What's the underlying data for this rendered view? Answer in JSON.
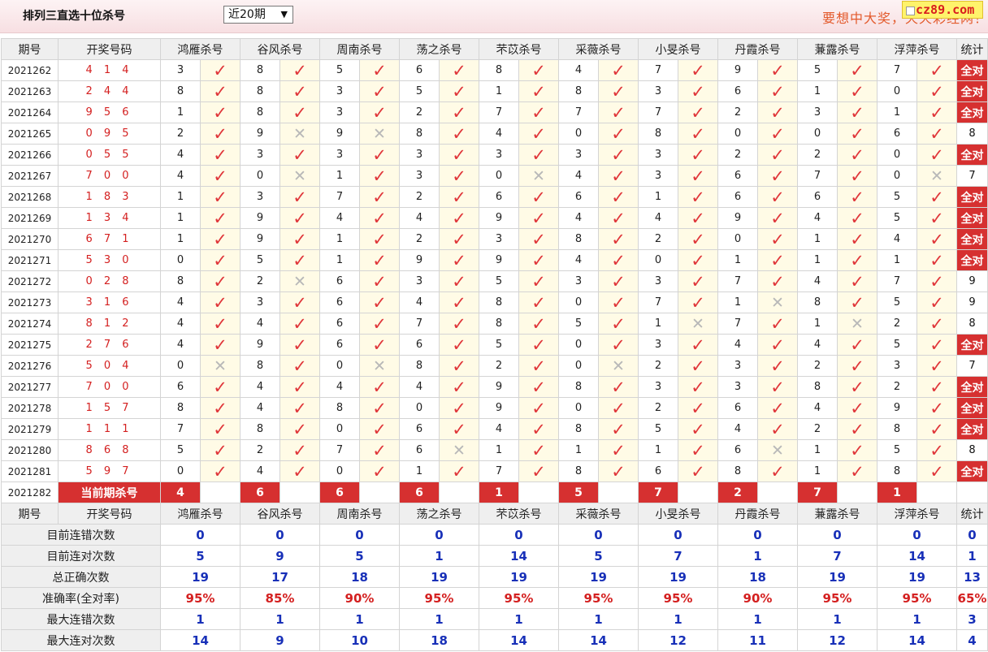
{
  "header": {
    "title": "排列三直选十位杀号",
    "select_value": "近20期",
    "slogan": "要想中大奖，天天彩经网！",
    "logo": "cz89.com"
  },
  "columns": {
    "issue": "期号",
    "draw": "开奖号码",
    "experts": [
      "鸿雁杀号",
      "谷风杀号",
      "周南杀号",
      "荡之杀号",
      "芣苡杀号",
      "采薇杀号",
      "小旻杀号",
      "丹霞杀号",
      "蒹露杀号",
      "浮萍杀号"
    ],
    "stat": "统计"
  },
  "rows": [
    {
      "issue": "2021262",
      "draw": "4 1 4",
      "kills": [
        3,
        8,
        5,
        6,
        8,
        4,
        7,
        9,
        5,
        7
      ],
      "ok": [
        1,
        1,
        1,
        1,
        1,
        1,
        1,
        1,
        1,
        1
      ],
      "stat": "全对"
    },
    {
      "issue": "2021263",
      "draw": "2 4 4",
      "kills": [
        8,
        8,
        3,
        5,
        1,
        8,
        3,
        6,
        1,
        0
      ],
      "ok": [
        1,
        1,
        1,
        1,
        1,
        1,
        1,
        1,
        1,
        1
      ],
      "stat": "全对"
    },
    {
      "issue": "2021264",
      "draw": "9 5 6",
      "kills": [
        1,
        8,
        3,
        2,
        7,
        7,
        7,
        2,
        3,
        1
      ],
      "ok": [
        1,
        1,
        1,
        1,
        1,
        1,
        1,
        1,
        1,
        1
      ],
      "stat": "全对"
    },
    {
      "issue": "2021265",
      "draw": "0 9 5",
      "kills": [
        2,
        9,
        9,
        8,
        4,
        0,
        8,
        0,
        0,
        6
      ],
      "ok": [
        1,
        0,
        0,
        1,
        1,
        1,
        1,
        1,
        1,
        1
      ],
      "stat": "8"
    },
    {
      "issue": "2021266",
      "draw": "0 5 5",
      "kills": [
        4,
        3,
        3,
        3,
        3,
        3,
        3,
        2,
        2,
        0
      ],
      "ok": [
        1,
        1,
        1,
        1,
        1,
        1,
        1,
        1,
        1,
        1
      ],
      "stat": "全对"
    },
    {
      "issue": "2021267",
      "draw": "7 0 0",
      "kills": [
        4,
        0,
        1,
        3,
        0,
        4,
        3,
        6,
        7,
        0
      ],
      "ok": [
        1,
        0,
        1,
        1,
        0,
        1,
        1,
        1,
        1,
        0
      ],
      "stat": "7"
    },
    {
      "issue": "2021268",
      "draw": "1 8 3",
      "kills": [
        1,
        3,
        7,
        2,
        6,
        6,
        1,
        6,
        6,
        5
      ],
      "ok": [
        1,
        1,
        1,
        1,
        1,
        1,
        1,
        1,
        1,
        1
      ],
      "stat": "全对"
    },
    {
      "issue": "2021269",
      "draw": "1 3 4",
      "kills": [
        1,
        9,
        4,
        4,
        9,
        4,
        4,
        9,
        4,
        5
      ],
      "ok": [
        1,
        1,
        1,
        1,
        1,
        1,
        1,
        1,
        1,
        1
      ],
      "stat": "全对"
    },
    {
      "issue": "2021270",
      "draw": "6 7 1",
      "kills": [
        1,
        9,
        1,
        2,
        3,
        8,
        2,
        0,
        1,
        4
      ],
      "ok": [
        1,
        1,
        1,
        1,
        1,
        1,
        1,
        1,
        1,
        1
      ],
      "stat": "全对"
    },
    {
      "issue": "2021271",
      "draw": "5 3 0",
      "kills": [
        0,
        5,
        1,
        9,
        9,
        4,
        0,
        1,
        1,
        1
      ],
      "ok": [
        1,
        1,
        1,
        1,
        1,
        1,
        1,
        1,
        1,
        1
      ],
      "stat": "全对"
    },
    {
      "issue": "2021272",
      "draw": "0 2 8",
      "kills": [
        8,
        2,
        6,
        3,
        5,
        3,
        3,
        7,
        4,
        7
      ],
      "ok": [
        1,
        0,
        1,
        1,
        1,
        1,
        1,
        1,
        1,
        1
      ],
      "stat": "9"
    },
    {
      "issue": "2021273",
      "draw": "3 1 6",
      "kills": [
        4,
        3,
        6,
        4,
        8,
        0,
        7,
        1,
        8,
        5
      ],
      "ok": [
        1,
        1,
        1,
        1,
        1,
        1,
        1,
        0,
        1,
        1
      ],
      "stat": "9"
    },
    {
      "issue": "2021274",
      "draw": "8 1 2",
      "kills": [
        4,
        4,
        6,
        7,
        8,
        5,
        1,
        7,
        1,
        2
      ],
      "ok": [
        1,
        1,
        1,
        1,
        1,
        1,
        0,
        1,
        0,
        1
      ],
      "stat": "8"
    },
    {
      "issue": "2021275",
      "draw": "2 7 6",
      "kills": [
        4,
        9,
        6,
        6,
        5,
        0,
        3,
        4,
        4,
        5
      ],
      "ok": [
        1,
        1,
        1,
        1,
        1,
        1,
        1,
        1,
        1,
        1
      ],
      "stat": "全对"
    },
    {
      "issue": "2021276",
      "draw": "5 0 4",
      "kills": [
        0,
        8,
        0,
        8,
        2,
        0,
        2,
        3,
        2,
        3
      ],
      "ok": [
        0,
        1,
        0,
        1,
        1,
        0,
        1,
        1,
        1,
        1
      ],
      "stat": "7"
    },
    {
      "issue": "2021277",
      "draw": "7 0 0",
      "kills": [
        6,
        4,
        4,
        4,
        9,
        8,
        3,
        3,
        8,
        2
      ],
      "ok": [
        1,
        1,
        1,
        1,
        1,
        1,
        1,
        1,
        1,
        1
      ],
      "stat": "全对"
    },
    {
      "issue": "2021278",
      "draw": "1 5 7",
      "kills": [
        8,
        4,
        8,
        0,
        9,
        0,
        2,
        6,
        4,
        9
      ],
      "ok": [
        1,
        1,
        1,
        1,
        1,
        1,
        1,
        1,
        1,
        1
      ],
      "stat": "全对"
    },
    {
      "issue": "2021279",
      "draw": "1 1 1",
      "kills": [
        7,
        8,
        0,
        6,
        4,
        8,
        5,
        4,
        2,
        8
      ],
      "ok": [
        1,
        1,
        1,
        1,
        1,
        1,
        1,
        1,
        1,
        1
      ],
      "stat": "全对"
    },
    {
      "issue": "2021280",
      "draw": "8 6 8",
      "kills": [
        5,
        2,
        7,
        6,
        1,
        1,
        1,
        6,
        1,
        5
      ],
      "ok": [
        1,
        1,
        1,
        0,
        1,
        1,
        1,
        0,
        1,
        1
      ],
      "stat": "8"
    },
    {
      "issue": "2021281",
      "draw": "5 9 7",
      "kills": [
        0,
        4,
        0,
        1,
        7,
        8,
        6,
        8,
        1,
        8
      ],
      "ok": [
        1,
        1,
        1,
        1,
        1,
        1,
        1,
        1,
        1,
        1
      ],
      "stat": "全对"
    }
  ],
  "current": {
    "issue": "2021282",
    "label": "当前期杀号",
    "kills": [
      "4",
      "6",
      "6",
      "6",
      "1",
      "5",
      "7",
      "2",
      "7",
      "1"
    ]
  },
  "stats": [
    {
      "label": "目前连错次数",
      "values": [
        "0",
        "0",
        "0",
        "0",
        "0",
        "0",
        "0",
        "0",
        "0",
        "0",
        "0"
      ],
      "color": "blue"
    },
    {
      "label": "目前连对次数",
      "values": [
        "5",
        "9",
        "5",
        "1",
        "14",
        "5",
        "7",
        "1",
        "7",
        "14",
        "1"
      ],
      "color": "blue"
    },
    {
      "label": "总正确次数",
      "values": [
        "19",
        "17",
        "18",
        "19",
        "19",
        "19",
        "19",
        "18",
        "19",
        "19",
        "13"
      ],
      "color": "blue"
    },
    {
      "label": "准确率(全对率)",
      "values": [
        "95%",
        "85%",
        "90%",
        "95%",
        "95%",
        "95%",
        "95%",
        "90%",
        "95%",
        "95%",
        "65%"
      ],
      "color": "red"
    },
    {
      "label": "最大连错次数",
      "values": [
        "1",
        "1",
        "1",
        "1",
        "1",
        "1",
        "1",
        "1",
        "1",
        "1",
        "3"
      ],
      "color": "blue"
    },
    {
      "label": "最大连对次数",
      "values": [
        "14",
        "9",
        "10",
        "18",
        "14",
        "14",
        "12",
        "11",
        "12",
        "14",
        "4"
      ],
      "color": "blue"
    }
  ],
  "icons": {
    "check": "✓",
    "cross": "✕",
    "dropdown": "▼"
  },
  "colors": {
    "accent_red": "#d63030",
    "check_red": "#e0363a",
    "blue": "#1830b8"
  }
}
